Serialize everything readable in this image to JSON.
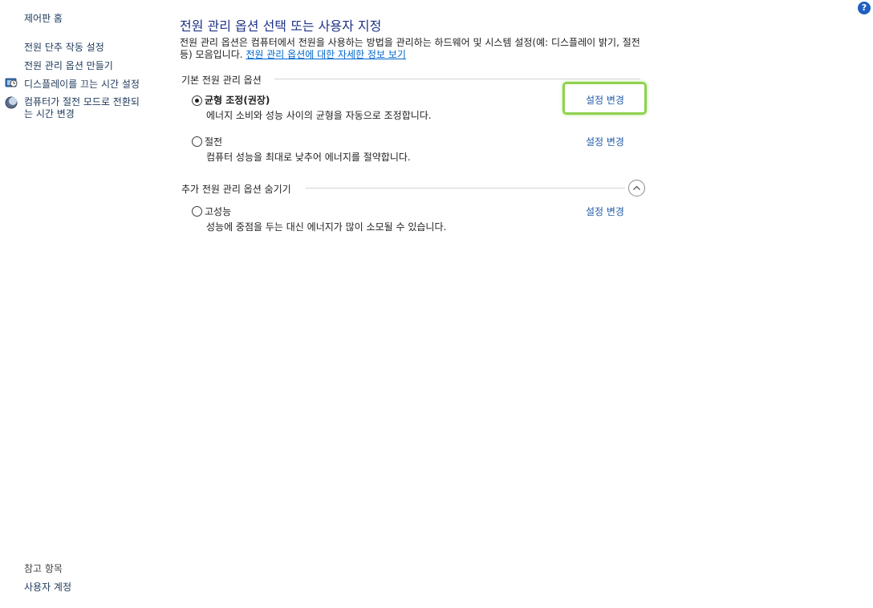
{
  "sidebar": {
    "home": "제어판 홈",
    "items": [
      {
        "label": "전원 단추 작동 설정",
        "icon": ""
      },
      {
        "label": "전원 관리 옵션 만들기",
        "icon": ""
      },
      {
        "label": "디스플레이를 끄는 시간 설정",
        "icon": "display-clock-icon"
      },
      {
        "label": "컴퓨터가 절전 모드로 전환되는 시간 변경",
        "icon": "sleep-moon-icon",
        "line1": "컴퓨터가 절전 모드로 전환되",
        "line2": "는 시간 변경"
      }
    ],
    "see_also": {
      "label": "참고 항목",
      "items": [
        "사용자 계정"
      ]
    }
  },
  "main": {
    "title": "전원 관리 옵션 선택 또는 사용자 지정",
    "description": "전원 관리 옵션은 컴퓨터에서 전원을 사용하는 방법을 관리하는 하드웨어 및 시스템 설정(예: 디스플레이 밝기, 절전 등) 모음입니다. ",
    "description_link": "전원 관리 옵션에 대한 자세한 정보 보기",
    "preferred_group": {
      "header": "기본 전원 관리 옵션",
      "plans": [
        {
          "name": "균형 조정(권장)",
          "desc": "에너지 소비와 성능 사이의 균형을 자동으로 조정합니다.",
          "link": "설정 변경",
          "selected": true
        },
        {
          "name": "절전",
          "desc": "컴퓨터 성능을 최대로 낮추어 에너지를 절약합니다.",
          "link": "설정 변경",
          "selected": false
        }
      ]
    },
    "additional_group": {
      "header": "추가 전원 관리 옵션 숨기기",
      "plans": [
        {
          "name": "고성능",
          "desc": "성능에 중점을 두는 대신 에너지가 많이 소모될 수 있습니다.",
          "link": "설정 변경",
          "selected": false
        }
      ]
    }
  },
  "help_label": "?",
  "colors": {
    "title": "#1e3287",
    "link": "#1e5aa8",
    "highlight": "#8fd14f"
  }
}
